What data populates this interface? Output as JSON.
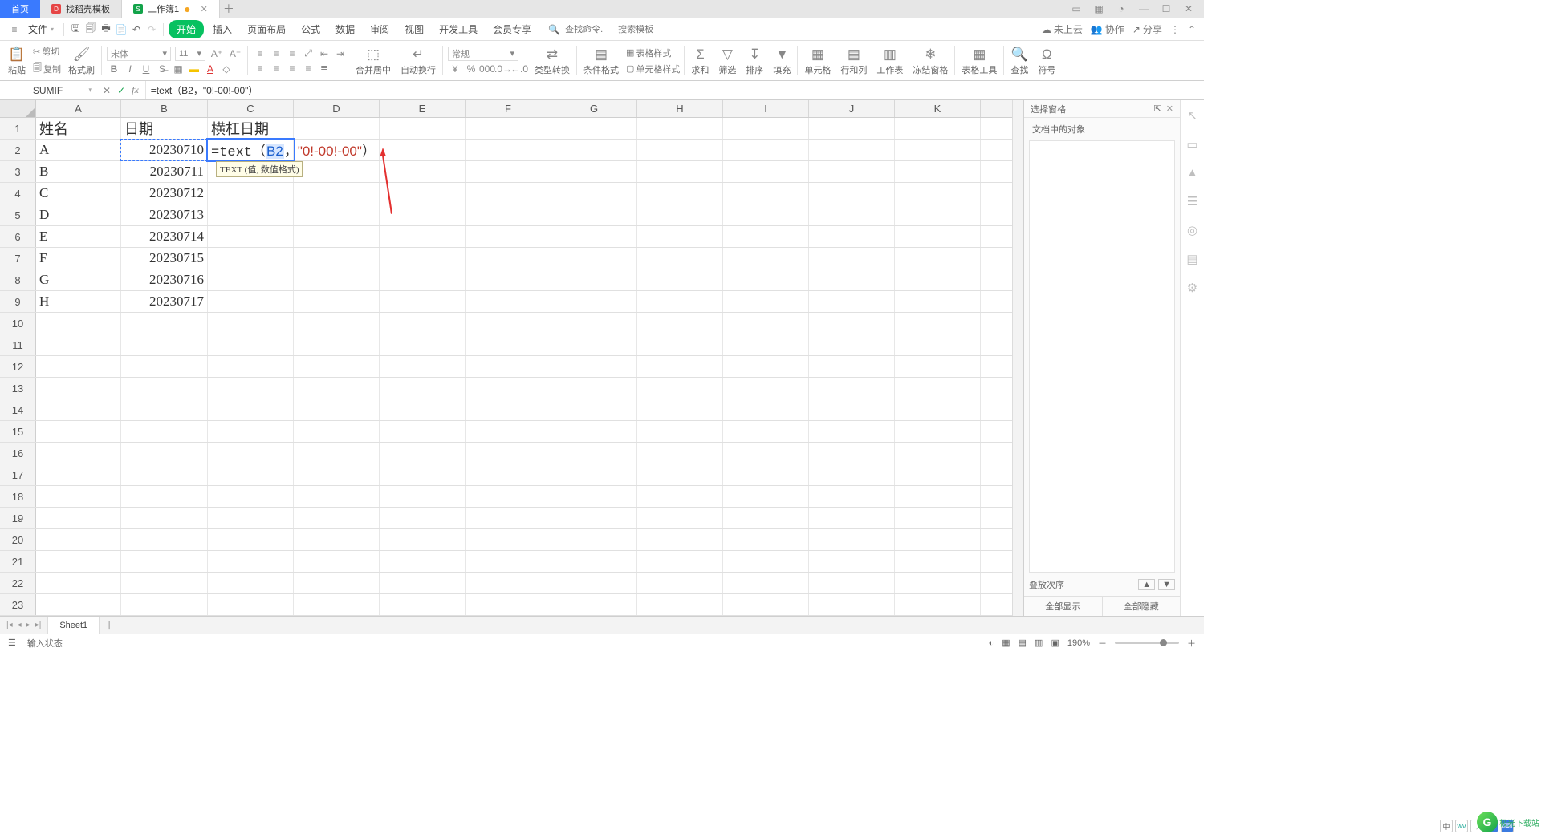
{
  "tabs": {
    "home": "首页",
    "t1_icon": "D",
    "t1_label": "找稻壳模板",
    "t2_icon": "S",
    "t2_label": "工作簿1"
  },
  "menubar": {
    "file": "文件",
    "items": [
      "开始",
      "插入",
      "页面布局",
      "公式",
      "数据",
      "审阅",
      "视图",
      "开发工具",
      "会员专享"
    ],
    "search_cmd_ph": "查找命令.",
    "search_tpl_ph": "搜索模板"
  },
  "topright": {
    "cloud": "未上云",
    "coop": "协作",
    "share": "分享"
  },
  "ribbon": {
    "paste": "粘贴",
    "cut": "剪切",
    "copy": "复制",
    "format_painter": "格式刷",
    "font_name": "宋体",
    "font_size": "11",
    "merge": "合并居中",
    "wrap": "自动换行",
    "num_format": "常规",
    "type_conv": "类型转换",
    "cond_fmt": "条件格式",
    "table_fmt": "表格样式",
    "cell_fmt": "单元格样式",
    "sum": "求和",
    "filter": "筛选",
    "sort": "排序",
    "fill": "填充",
    "cells": "单元格",
    "rowscols": "行和列",
    "sheet": "工作表",
    "freeze": "冻结窗格",
    "table_tools": "表格工具",
    "find": "查找",
    "symbol": "符号"
  },
  "namebox": "SUMIF",
  "formula_bar": "=text（B2，\"0!-00!-00\"）",
  "columns": [
    "A",
    "B",
    "C",
    "D",
    "E",
    "F",
    "G",
    "H",
    "I",
    "J",
    "K"
  ],
  "row_numbers": [
    1,
    2,
    3,
    4,
    5,
    6,
    7,
    8,
    9,
    10,
    11,
    12,
    13,
    14,
    15,
    16,
    17,
    18,
    19,
    20,
    21,
    22,
    23
  ],
  "data": {
    "headers": {
      "A": "姓名",
      "B": "日期",
      "C": "横杠日期"
    },
    "rows": [
      {
        "A": "A",
        "B": "20230710"
      },
      {
        "A": "B",
        "B": "20230711"
      },
      {
        "A": "C",
        "B": "20230712"
      },
      {
        "A": "D",
        "B": "20230713"
      },
      {
        "A": "E",
        "B": "20230714"
      },
      {
        "A": "F",
        "B": "20230715"
      },
      {
        "A": "G",
        "B": "20230716"
      },
      {
        "A": "H",
        "B": "20230717"
      }
    ],
    "editing_cell": {
      "pre": "=text（",
      "ref": "B2",
      "mid": "，",
      "str": "\"0!-00!-00\"",
      "post": "）"
    },
    "tooltip": "TEXT (值, 数值格式)"
  },
  "rightpanel": {
    "title": "选择窗格",
    "sub": "文档中的对象",
    "layer": "叠放次序",
    "show_all": "全部显示",
    "hide_all": "全部隐藏"
  },
  "sheet": {
    "nav": [
      "|◂",
      "◂",
      "▸",
      "▸|"
    ],
    "name": "Sheet1"
  },
  "status": {
    "left_icon": "☰",
    "mode": "输入状态",
    "zoom": "190%"
  },
  "corner_logo": "极光下载站"
}
